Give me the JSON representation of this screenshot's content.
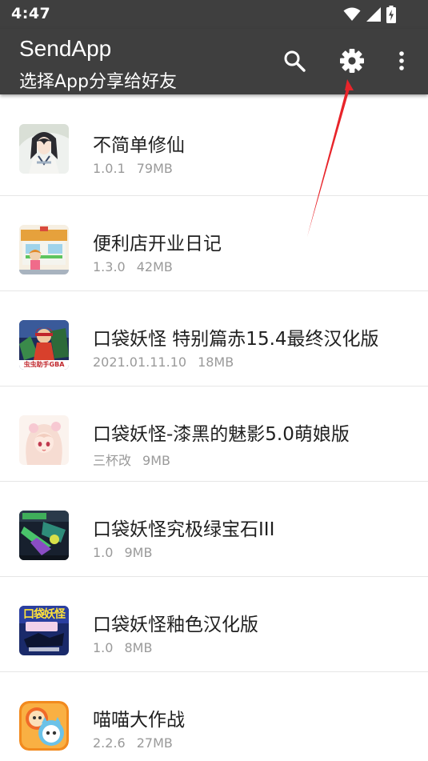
{
  "status_bar": {
    "time": "4:47",
    "icons": [
      "wifi-icon",
      "cell-signal-icon",
      "battery-charging-icon"
    ]
  },
  "app_bar": {
    "title": "SendApp",
    "subtitle": "选择App分享给好友",
    "background_color": "#3f3f3f",
    "actions": [
      "search-icon",
      "gear-icon",
      "more-vertical-icon"
    ]
  },
  "apps": [
    {
      "name": "不简单修仙",
      "version": "1.0.1",
      "size": "79MB",
      "icon": "app-icon-xiuxian"
    },
    {
      "name": "便利店开业日记",
      "version": "1.3.0",
      "size": "42MB",
      "icon": "app-icon-store"
    },
    {
      "name": "口袋妖怪 特别篇赤15.4最终汉化版",
      "version": "2021.01.11.10",
      "size": "18MB",
      "icon": "app-icon-gba-red",
      "icon_caption": "虫虫助手GBA"
    },
    {
      "name": "口袋妖怪-漆黑的魅影5.0萌娘版",
      "version": "三杯改",
      "size": "9MB",
      "icon": "app-icon-anime-girl"
    },
    {
      "name": "口袋妖怪究极绿宝石III",
      "version": "1.0",
      "size": "9MB",
      "icon": "app-icon-emerald"
    },
    {
      "name": "口袋妖怪釉色汉化版",
      "version": "1.0",
      "size": "8MB",
      "icon": "app-icon-glaze",
      "icon_caption": "口袋妖怪"
    },
    {
      "name": "喵喵大作战",
      "version": "2.2.6",
      "size": "27MB",
      "icon": "app-icon-cats"
    }
  ],
  "annotation": {
    "color": "#e8242a",
    "target": "gear-icon"
  }
}
